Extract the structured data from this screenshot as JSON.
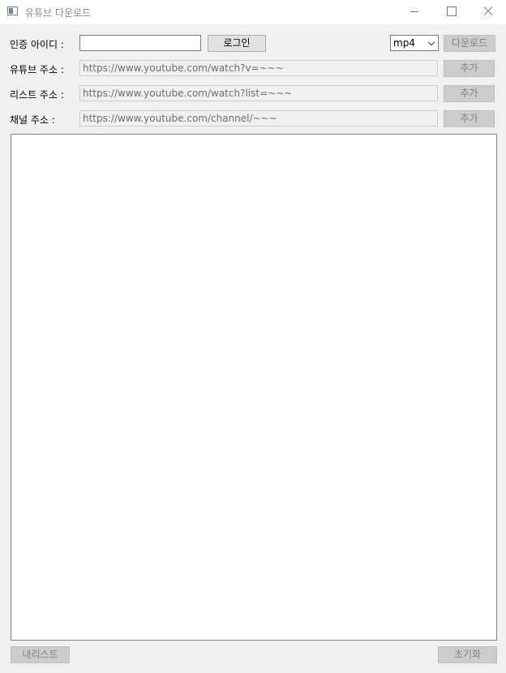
{
  "window": {
    "title": "유튜브 다운로드",
    "icon": "app-window-icon"
  },
  "auth": {
    "label": "인증 아이디 :",
    "value": "",
    "login_label": "로그인"
  },
  "format": {
    "selected": "mp4",
    "download_label": "다운로드"
  },
  "rows": {
    "video": {
      "label": "유튜브 주소 :",
      "value": "https://www.youtube.com/watch?v=~~~",
      "add_label": "추가"
    },
    "list": {
      "label": "리스트 주소 :",
      "value": "https://www.youtube.com/watch?list=~~~",
      "add_label": "추가"
    },
    "channel": {
      "label": "채널 주소 :",
      "value": "https://www.youtube.com/channel/~~~",
      "add_label": "추가"
    }
  },
  "footer": {
    "my_list_label": "내리스트",
    "reset_label": "초기화"
  }
}
